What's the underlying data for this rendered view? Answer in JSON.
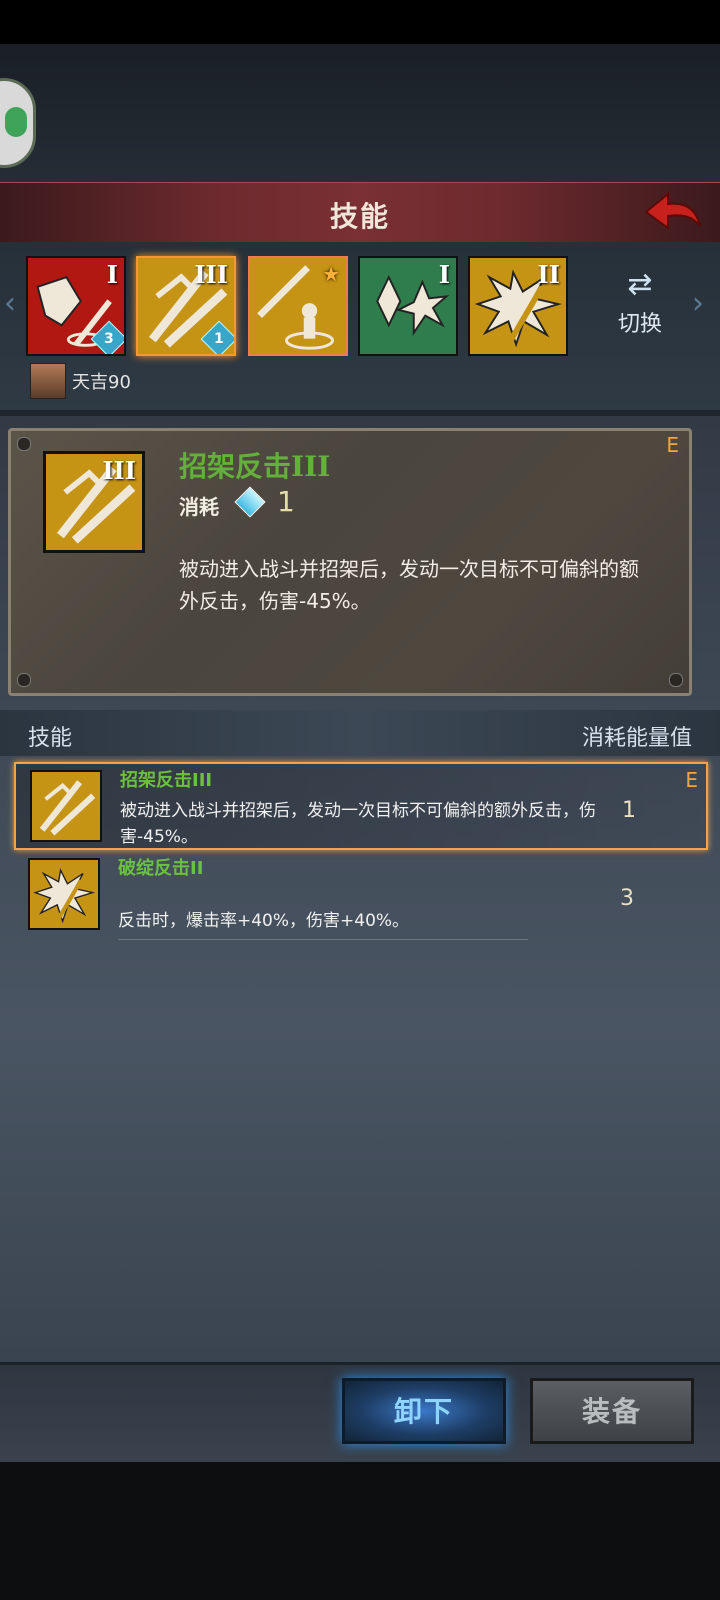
{
  "header": {
    "title": "技能",
    "back_icon": "back-arrow-icon"
  },
  "skills_strip": {
    "tiles": [
      {
        "name": "skill-slot-1",
        "roman": "I",
        "badge": "3",
        "bg": "#b11812",
        "fg": "#f4f0e4"
      },
      {
        "name": "skill-slot-2",
        "roman": "III",
        "badge": "1",
        "bg": "#c69414",
        "fg": "#f4f0e4"
      },
      {
        "name": "skill-slot-3",
        "roman": "",
        "badge": "",
        "bg": "#c69414",
        "fg": "#f4f0e4",
        "star": true
      },
      {
        "name": "skill-slot-4",
        "roman": "I",
        "badge": "",
        "bg": "#2f7c4c",
        "fg": "#f4f0e4"
      },
      {
        "name": "skill-slot-5",
        "roman": "II",
        "badge": "",
        "bg": "#c69414",
        "fg": "#f4f0e4"
      }
    ],
    "switch_label": "切换"
  },
  "owner": {
    "name": "天吉90"
  },
  "detail": {
    "title": "招架反击",
    "title_roman": "III",
    "cost_label": "消耗",
    "cost_value": "1",
    "grade": "E",
    "icon_roman": "III",
    "description": "被动进入战斗并招架后，发动一次目标不可偏斜的额外反击，伤害-45%。"
  },
  "list": {
    "header_left": "技能",
    "header_right": "消耗能量值",
    "rows": [
      {
        "title": "招架反击III",
        "description": "被动进入战斗并招架后，发动一次目标不可偏斜的额外反击，伤害-45%。",
        "cost": "1",
        "grade": "E",
        "selected": true
      },
      {
        "title": "破绽反击II",
        "description": "反击时，爆击率+40%，伤害+40%。",
        "cost": "3",
        "grade": "",
        "selected": false
      }
    ]
  },
  "buttons": {
    "unequip": "卸下",
    "equip": "装备"
  },
  "colors": {
    "accent_orange": "#f3a24a",
    "title_green": "#63b13a",
    "header_red": "#6d2a2e"
  }
}
